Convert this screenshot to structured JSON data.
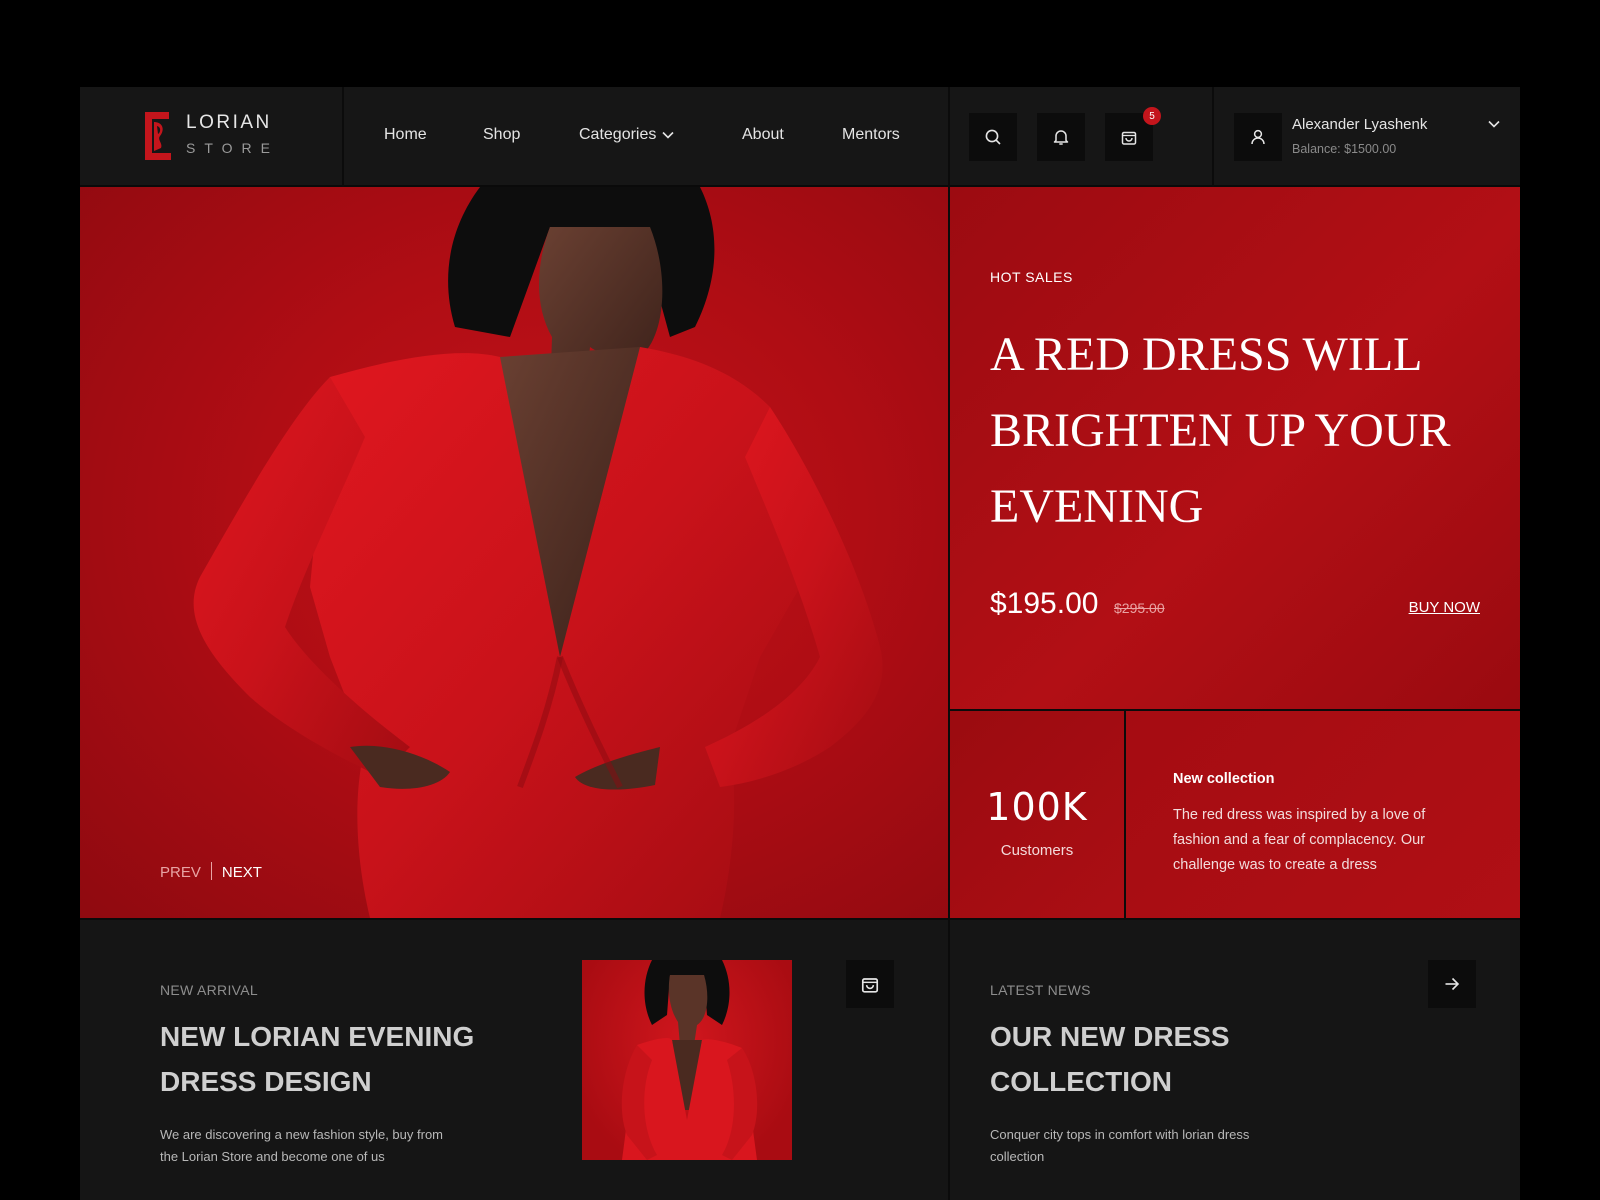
{
  "brand": {
    "name": "LORIAN",
    "sub": "STORE",
    "accent": "#c4151c"
  },
  "nav": {
    "home": "Home",
    "shop": "Shop",
    "categories": "Categories",
    "about": "About",
    "mentors": "Mentors"
  },
  "tools": {
    "cart_count": "5"
  },
  "user": {
    "name": "Alexander Lyashenk",
    "balance": "Balance: $1500.00"
  },
  "hero": {
    "prev": "PREV",
    "next": "NEXT"
  },
  "promo": {
    "tag": "HOT SALES",
    "title_lines": [
      "A RED DRESS WILL",
      "BRIGHTEN UP YOUR",
      "EVENING"
    ],
    "price": "$195.00",
    "old_price": "$295.00",
    "cta": "BUY NOW"
  },
  "stat": {
    "value": "100K",
    "label": "Customers"
  },
  "collection": {
    "title": "New collection",
    "text": "The red dress was inspired by a love of fashion and a fear of complacency. Our challenge was to create a dress"
  },
  "arrival": {
    "tag": "NEW ARRIVAL",
    "title_lines": [
      "NEW LORIAN EVENING",
      "DRESS DESIGN"
    ],
    "text": "We are discovering a new fashion style, buy from the Lorian Store and become one of us"
  },
  "news": {
    "tag": "LATEST NEWS",
    "title_lines": [
      "OUR NEW DRESS",
      "COLLECTION"
    ],
    "text": "Conquer city tops in comfort with lorian dress collection"
  },
  "icons": {
    "search": "search-icon",
    "bell": "bell-icon",
    "cart": "shopping-bag-icon",
    "user": "user-icon",
    "chevron": "chevron-down-icon",
    "arrow": "arrow-right-icon"
  }
}
